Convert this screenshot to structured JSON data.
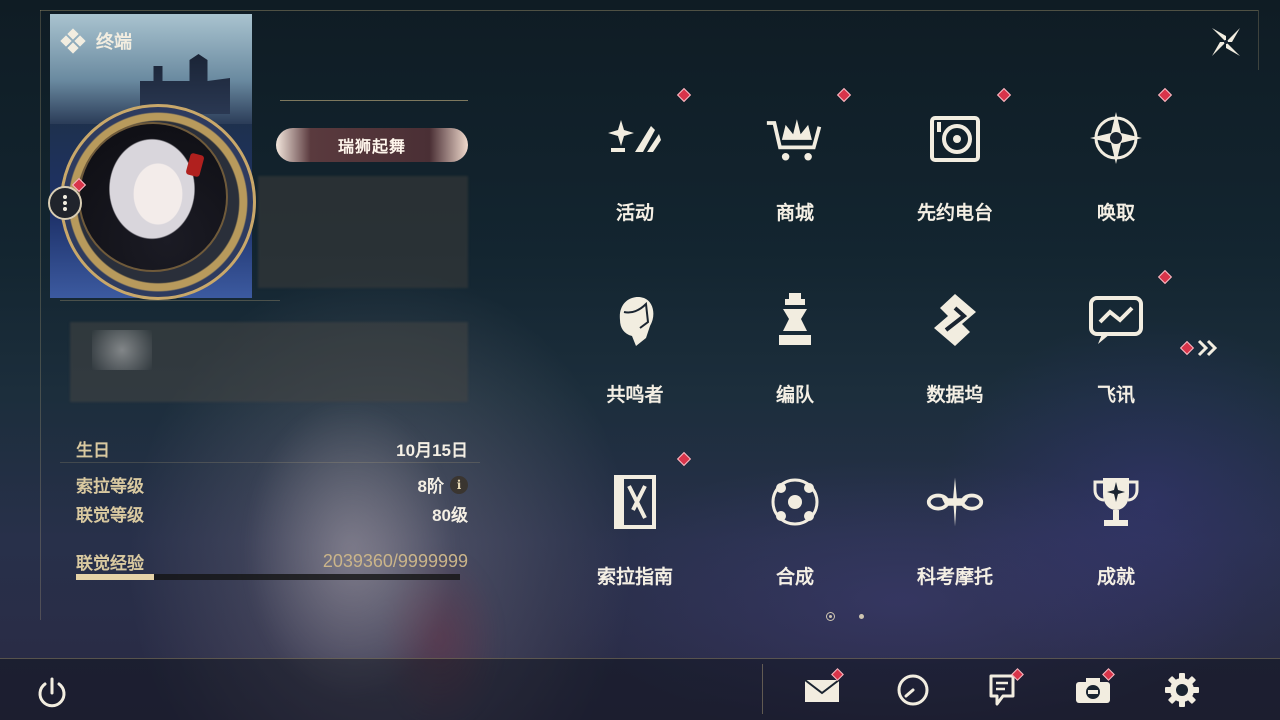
{
  "header": {
    "title": "终端",
    "diamond_icon": "diamond-cluster-icon",
    "close_icon": "close-x-icon"
  },
  "profile": {
    "title_badge": "瑞狮起舞",
    "stats": [
      {
        "label": "生日",
        "value": "10月15日"
      },
      {
        "label": "索拉等级",
        "value": "8阶",
        "has_info": true
      },
      {
        "label": "联觉等级",
        "value": "80级"
      },
      {
        "label": "联觉经验",
        "value": "2039360/9999999"
      }
    ],
    "xp_progress": 0.2039,
    "info_glyph": "i"
  },
  "menu": {
    "items": [
      {
        "label": "活动",
        "icon": "sparkle-events-icon",
        "badge": true
      },
      {
        "label": "商城",
        "icon": "crown-cart-icon",
        "badge": true
      },
      {
        "label": "先约电台",
        "icon": "radio-record-icon",
        "badge": true
      },
      {
        "label": "唤取",
        "icon": "compass-star-icon",
        "badge": true
      },
      {
        "label": "共鸣者",
        "icon": "character-head-icon",
        "badge": false
      },
      {
        "label": "编队",
        "icon": "chess-piece-icon",
        "badge": false
      },
      {
        "label": "数据坞",
        "icon": "data-dock-icon",
        "badge": false
      },
      {
        "label": "飞讯",
        "icon": "chat-bubble-icon",
        "badge": true
      },
      {
        "label": "索拉指南",
        "icon": "guide-book-icon",
        "badge": true
      },
      {
        "label": "合成",
        "icon": "synthesis-orbit-icon",
        "badge": false
      },
      {
        "label": "科考摩托",
        "icon": "motorcycle-icon",
        "badge": false
      },
      {
        "label": "成就",
        "icon": "trophy-icon",
        "badge": false
      }
    ],
    "next_page_icon": "double-chevron-right-icon",
    "pager": {
      "pages": 2,
      "current": 1
    }
  },
  "bottom_bar": {
    "power_icon": "power-icon",
    "icons": [
      {
        "name": "mail-icon",
        "badge": true
      },
      {
        "name": "clock-icon",
        "badge": false
      },
      {
        "name": "notice-icon",
        "badge": true
      },
      {
        "name": "camera-icon",
        "badge": true
      },
      {
        "name": "settings-gear-icon",
        "badge": false
      }
    ]
  },
  "colors": {
    "accent_gold": "#c9a86a",
    "badge_red": "#d8344a",
    "text_light": "#f4efe4",
    "label_gold": "#d9c9a0"
  }
}
